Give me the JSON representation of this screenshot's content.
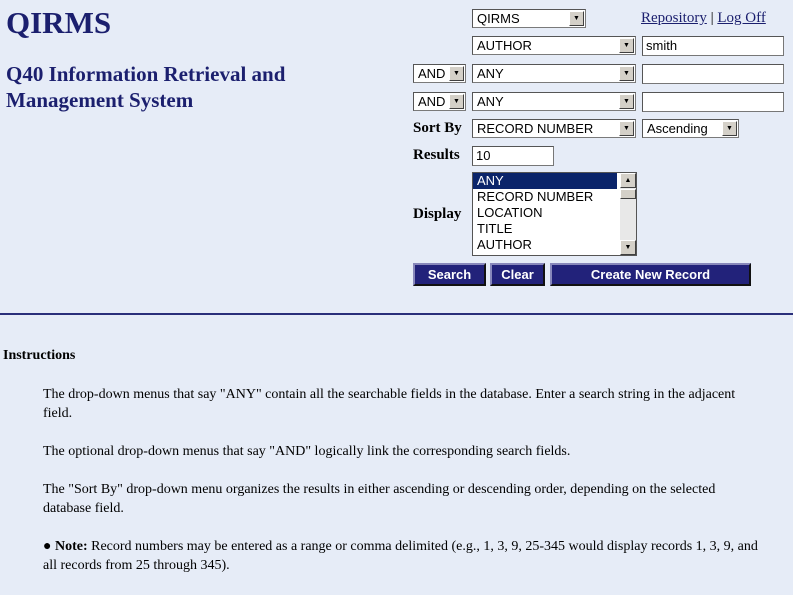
{
  "header": {
    "title": "QIRMS",
    "subtitle_line1": "Q40 Information Retrieval and",
    "subtitle_line2": "Management System"
  },
  "links": {
    "repository": "Repository",
    "separator": "|",
    "logoff": "Log Off"
  },
  "form": {
    "database": "QIRMS",
    "row1": {
      "field": "AUTHOR",
      "value": "smith"
    },
    "row2": {
      "op": "AND",
      "field": "ANY",
      "value": ""
    },
    "row3": {
      "op": "AND",
      "field": "ANY",
      "value": ""
    },
    "sort_label": "Sort By",
    "sort_field": "RECORD NUMBER",
    "sort_order": "Ascending",
    "results_label": "Results",
    "results_value": "10",
    "display_label": "Display",
    "display_options": [
      "ANY",
      "RECORD NUMBER",
      "LOCATION",
      "TITLE",
      "AUTHOR"
    ],
    "display_selected": "ANY"
  },
  "buttons": {
    "search": "Search",
    "clear": "Clear",
    "create": "Create New Record"
  },
  "instructions": {
    "heading": "Instructions",
    "p1": "The drop-down menus that say \"ANY\" contain all the searchable fields in the database. Enter a search string in the adjacent field.",
    "p2": "The optional drop-down menus that say \"AND\" logically link the corresponding search fields.",
    "p3": "The \"Sort By\" drop-down menu organizes the results in either ascending or descending order, depending on the selected database field.",
    "note_label": "Note:",
    "note": "Record numbers may be entered as a range or comma delimited (e.g., 1, 3, 9, 25-345 would display records 1, 3, 9, and all records from 25 through 345)."
  },
  "colors": {
    "background": "#e6ecf7",
    "brand": "#1b1f6e",
    "button": "#22227a"
  }
}
